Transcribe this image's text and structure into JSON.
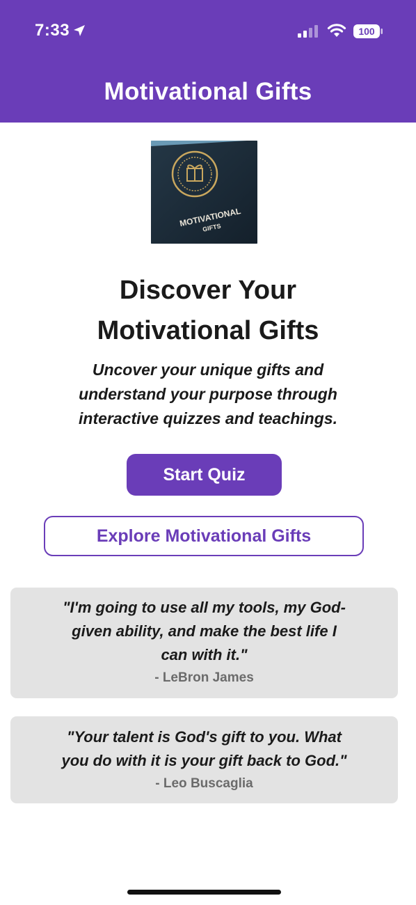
{
  "status_bar": {
    "time": "7:33",
    "battery": "100",
    "icons": [
      "location-arrow-icon",
      "signal-icon",
      "wifi-icon",
      "battery-icon"
    ]
  },
  "header": {
    "title": "Motivational Gifts",
    "background_color": "#6a3db8"
  },
  "logo": {
    "alt": "Motivational Gifts logo",
    "text_line1": "MOTIVATIONAL",
    "text_line2": "GIFTS"
  },
  "hero": {
    "title_line1": "Discover Your",
    "title_line2": "Motivational Gifts",
    "subtitle_line1": "Uncover your unique gifts and",
    "subtitle_line2": "understand your purpose through",
    "subtitle_line3": "interactive quizzes and teachings."
  },
  "actions": {
    "start_quiz_label": "Start Quiz",
    "explore_label": "Explore Motivational Gifts",
    "accent_color": "#6a3db8"
  },
  "quotes": [
    {
      "line1": "\"I'm going to use all my tools, my God-",
      "line2": "given ability, and make the best life I",
      "line3": "can with it.\"",
      "author": "- LeBron James"
    },
    {
      "line1": "\"Your talent is God's gift to you. What",
      "line2": "you do with it is your gift back to God.\"",
      "author": "- Leo Buscaglia"
    }
  ]
}
